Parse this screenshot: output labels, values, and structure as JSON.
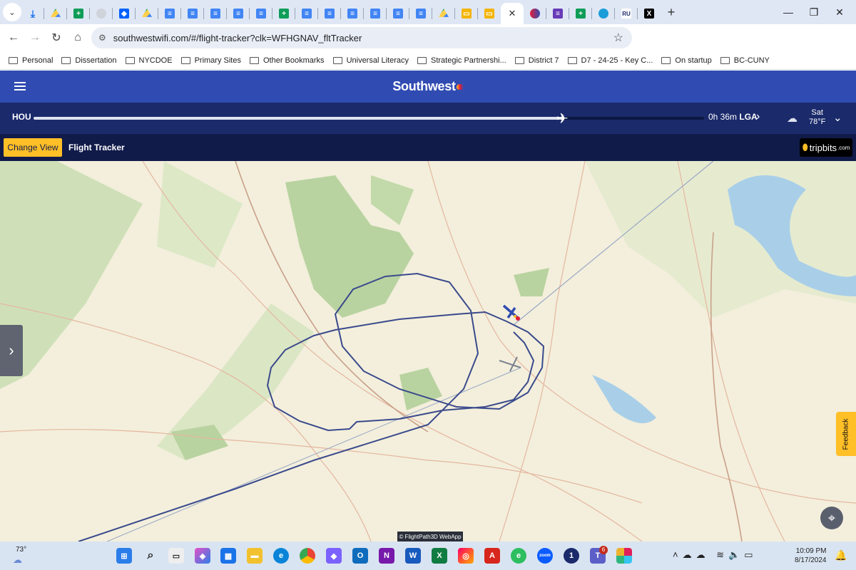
{
  "browser": {
    "url": "southwestwifi.com/#/flight-tracker?clk=WFHGNAV_fltTracker",
    "bookmarks": [
      "Personal",
      "Dissertation",
      "NYCDOE",
      "Primary Sites",
      "Other Bookmarks",
      "Universal Literacy",
      "Strategic Partnershi...",
      "District 7",
      "D7 - 24-25 - Key C...",
      "On startup",
      "BC-CUNY"
    ],
    "tab_icons": [
      "download-icon",
      "google-drive-icon",
      "google-sheets-icon",
      "profile-icon",
      "dropbox-icon",
      "google-drive-icon",
      "google-docs-icon",
      "google-docs-icon",
      "google-docs-icon",
      "google-docs-icon",
      "google-docs-icon",
      "google-sheets-icon",
      "google-docs-icon",
      "google-docs-icon",
      "google-docs-icon",
      "google-docs-icon",
      "google-docs-icon",
      "google-docs-icon",
      "google-drive-icon",
      "google-slides-icon",
      "google-slides-icon",
      "close-icon",
      "southwest-icon",
      "forms-icon",
      "google-sheets-icon",
      "chat-icon",
      "ru-icon",
      "x-icon"
    ]
  },
  "southwest": {
    "logo": "Southwest",
    "origin": "HOU",
    "destination": "LGA",
    "time_remaining": "0h 36m",
    "progress_fraction": 0.79,
    "weather_day": "Sat",
    "weather_temp": "78°F",
    "change_view_label": "Change View",
    "tracker_title": "Flight Tracker",
    "tripbits_label": "tripbits",
    "tripbits_suffix": ".com",
    "feedback_label": "Feedback",
    "attribution": "© FlightPath3D WebApp"
  },
  "taskbar": {
    "temperature": "73°",
    "time": "10:09 PM",
    "date": "8/17/2024",
    "teams_badge": "6"
  },
  "colors": {
    "southwest_blue": "#304cb2",
    "southwest_yellow": "#ffbf27",
    "navy": "#111b4a"
  }
}
